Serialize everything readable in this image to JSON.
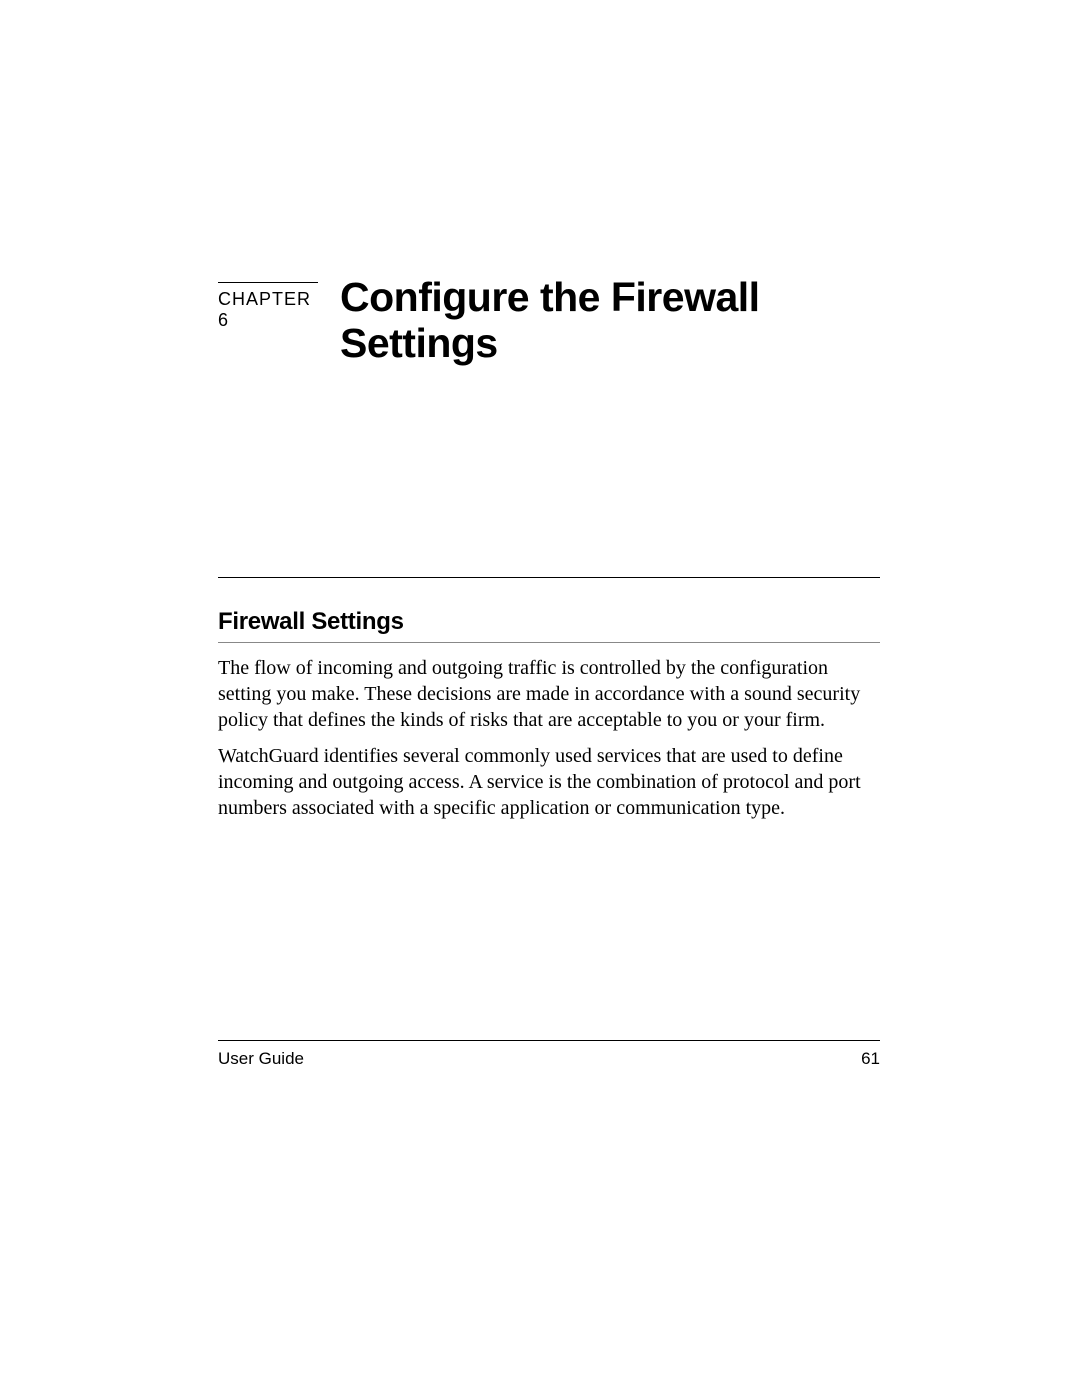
{
  "chapter": {
    "label": "CHAPTER 6",
    "title": "Configure the Firewall Settings"
  },
  "section": {
    "heading": "Firewall Settings",
    "paragraphs": [
      "The flow of incoming and outgoing traffic is controlled by the configuration setting you make. These decisions are made in accordance with a sound security policy that defines the kinds of risks that are acceptable to you or your firm.",
      "WatchGuard identifies several commonly used services that are used to define incoming and outgoing access. A service is the combination of protocol and port numbers associated with a specific application or communication type."
    ]
  },
  "footer": {
    "left": "User Guide",
    "right": "61"
  }
}
